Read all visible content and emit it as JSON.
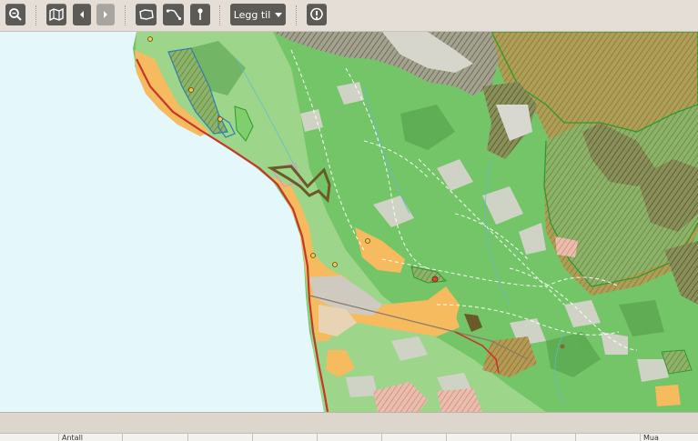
{
  "toolbar": {
    "zoom_tool": "zoom-icon",
    "map_layers_tool": "map-icon",
    "back_tool": "arrow-left-icon",
    "forward_tool": "arrow-right-icon",
    "area_tool": "polygon-icon",
    "line_tool": "line-icon",
    "point_tool": "pin-icon",
    "add_label": "Legg til",
    "info_tool": "info-icon"
  },
  "table": {
    "columns": [
      "",
      "Antall",
      "",
      "",
      "",
      "",
      "",
      "",
      "",
      "",
      "Mua"
    ]
  },
  "colors": {
    "sea": "#e4f8fc",
    "forest": "#6cbf5e",
    "settlement": "#f6bb5e",
    "road": "#c73628"
  }
}
